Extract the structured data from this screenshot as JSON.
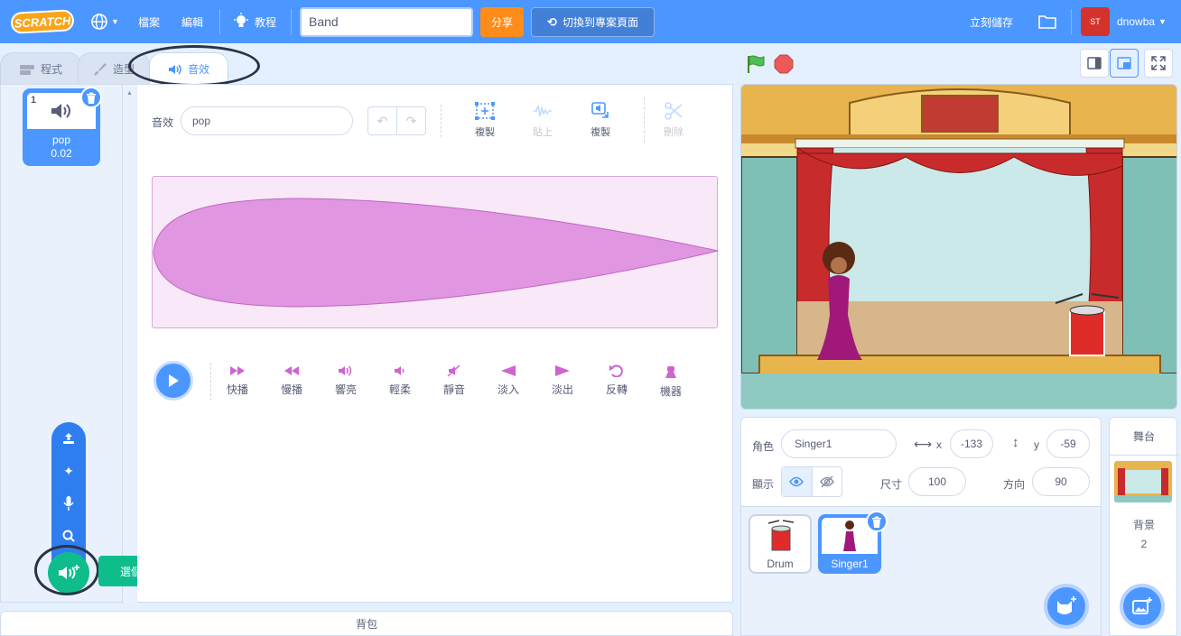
{
  "menubar": {
    "logo": "SCRATCH",
    "file": "檔案",
    "edit": "編輯",
    "tutorials": "教程",
    "project_title": "Band",
    "share": "分享",
    "see_project_page": "切換到專案頁面",
    "save_now": "立刻儲存",
    "username": "dnowba",
    "avatar_text": "ST"
  },
  "tabs": {
    "code": "程式",
    "costumes": "造型",
    "sounds": "音效"
  },
  "sound_list": {
    "items": [
      {
        "index": "1",
        "name": "pop",
        "length": "0.02"
      }
    ],
    "choose_sound_tooltip": "選個音效"
  },
  "editor": {
    "sound_label": "音效",
    "sound_name": "pop",
    "tools": {
      "copy": "複製",
      "paste": "貼上",
      "copy_to_new": "複製",
      "delete": "刪除"
    },
    "effects": [
      "快播",
      "慢播",
      "響亮",
      "輕柔",
      "靜音",
      "淡入",
      "淡出",
      "反轉",
      "機器"
    ],
    "backpack": "背包"
  },
  "sprite_info": {
    "sprite_label": "角色",
    "sprite_name": "Singer1",
    "x_label": "x",
    "x_value": "-133",
    "y_label": "y",
    "y_value": "-59",
    "show_label": "顯示",
    "size_label": "尺寸",
    "size_value": "100",
    "direction_label": "方向",
    "direction_value": "90"
  },
  "sprites": [
    {
      "name": "Drum",
      "selected": false
    },
    {
      "name": "Singer1",
      "selected": true
    }
  ],
  "stage_panel": {
    "title": "舞台",
    "backdrops_label": "背景",
    "backdrops_count": "2"
  },
  "colors": {
    "menubar": "#4c97ff",
    "share": "#ff8c1a",
    "sound_add": "#0fbd8c",
    "sound_effect": "#cf63cf",
    "waveform": "#e196e1"
  }
}
